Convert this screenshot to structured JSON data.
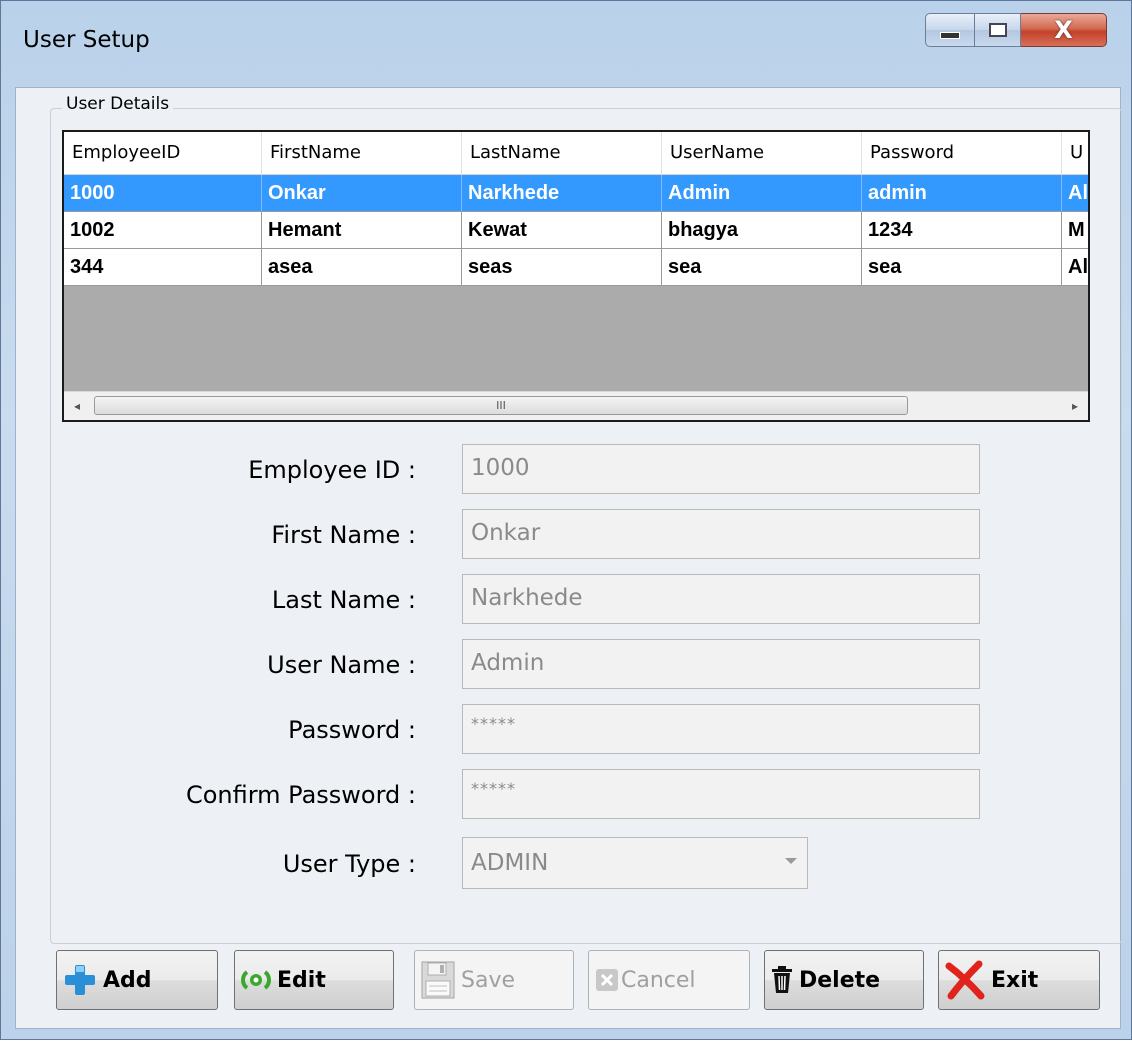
{
  "window": {
    "title": "User Setup",
    "close_glyph": "X"
  },
  "group": {
    "label": "User Details"
  },
  "grid": {
    "columns": [
      "EmployeeID",
      "FirstName",
      "LastName",
      "UserName",
      "Password",
      "U"
    ],
    "rows": [
      [
        "1000",
        "Onkar",
        "Narkhede",
        "Admin",
        "admin",
        "Al"
      ],
      [
        "1002",
        "Hemant",
        "Kewat",
        "bhagya",
        "1234",
        "M"
      ],
      [
        "344",
        "asea",
        "seas",
        "sea",
        "sea",
        "Al"
      ]
    ],
    "selected_row_index": 0,
    "scroll_left_glyph": "◂",
    "scroll_right_glyph": "▸",
    "scroll_grip": "III"
  },
  "form": {
    "employee_id": {
      "label": "Employee ID :",
      "value": "1000"
    },
    "first_name": {
      "label": "First Name :",
      "value": "Onkar"
    },
    "last_name": {
      "label": "Last Name :",
      "value": "Narkhede"
    },
    "user_name": {
      "label": "User Name :",
      "value": "Admin"
    },
    "password": {
      "label": "Password :",
      "value": "*****"
    },
    "confirm_password": {
      "label": "Confirm Password :",
      "value": "*****"
    },
    "user_type": {
      "label": "User Type :",
      "value": "ADMIN"
    }
  },
  "buttons": {
    "add": "Add",
    "edit": "Edit",
    "save": "Save",
    "cancel": "Cancel",
    "delete": "Delete",
    "exit": "Exit"
  },
  "colors": {
    "selection": "#3399ff",
    "add_icon": "#2a8fd6",
    "edit_icon": "#3aa82e",
    "exit_icon": "#e0231b"
  }
}
